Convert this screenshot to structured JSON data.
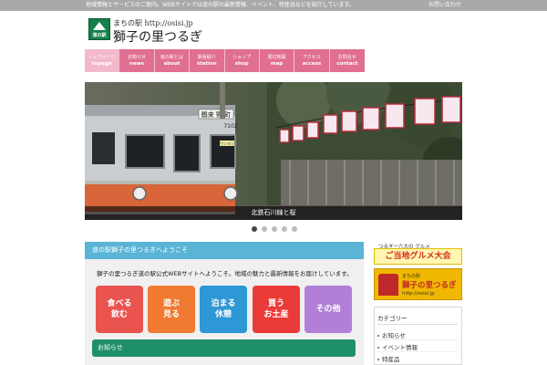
{
  "topbar": {
    "message": "地域情報とサービスのご案内。WEBサイトでは道の駅の最新情報、イベント、特産品などを紹介しています。",
    "link": "お問い合わせ"
  },
  "header": {
    "logo_text": "道の駅",
    "subtitle": "まちの駅 http://osisi.jp",
    "title": "獅子の里つるぎ"
  },
  "nav": {
    "items": [
      {
        "jp": "トップページ",
        "en": "topage"
      },
      {
        "jp": "お知らせ",
        "en": "news"
      },
      {
        "jp": "道の駅とは",
        "en": "about"
      },
      {
        "jp": "駅舎紹介",
        "en": "station"
      },
      {
        "jp": "ショップ",
        "en": "shop"
      },
      {
        "jp": "周辺地図",
        "en": "map"
      },
      {
        "jp": "アクセス",
        "en": "access"
      },
      {
        "jp": "お問合せ",
        "en": "contact"
      }
    ]
  },
  "slider": {
    "caption": "北鉄石川線と桜",
    "train_sign": "鶴来 野 町",
    "train_number": "7102",
    "oneman": "ワンマン"
  },
  "main": {
    "header": "道の駅獅子の里つるぎへようこそ",
    "intro": "獅子の里つるぎ道の駅公式WEBサイトへようこそ。地域の魅力と最新情報をお届けしています。",
    "categories": [
      {
        "line1": "食べる",
        "line2": "飲む"
      },
      {
        "line1": "遊ぶ",
        "line2": "見る"
      },
      {
        "line1": "泊まる",
        "line2": "休憩"
      },
      {
        "line1": "買う",
        "line2": "お土産"
      },
      {
        "line1": "その他",
        "line2": ""
      }
    ],
    "section_title": "お知らせ"
  },
  "sidebar": {
    "gourmet_label": "つるぎー六大の グルメ",
    "gourmet_banner": "ご当地グルメ大会",
    "banner_sub": "まちの駅",
    "banner_title": "獅子の里つるぎ",
    "banner_url": "http://osisi.jp",
    "box_title": "カテゴリー",
    "items": [
      "お知らせ",
      "イベント情報",
      "特産品"
    ]
  }
}
